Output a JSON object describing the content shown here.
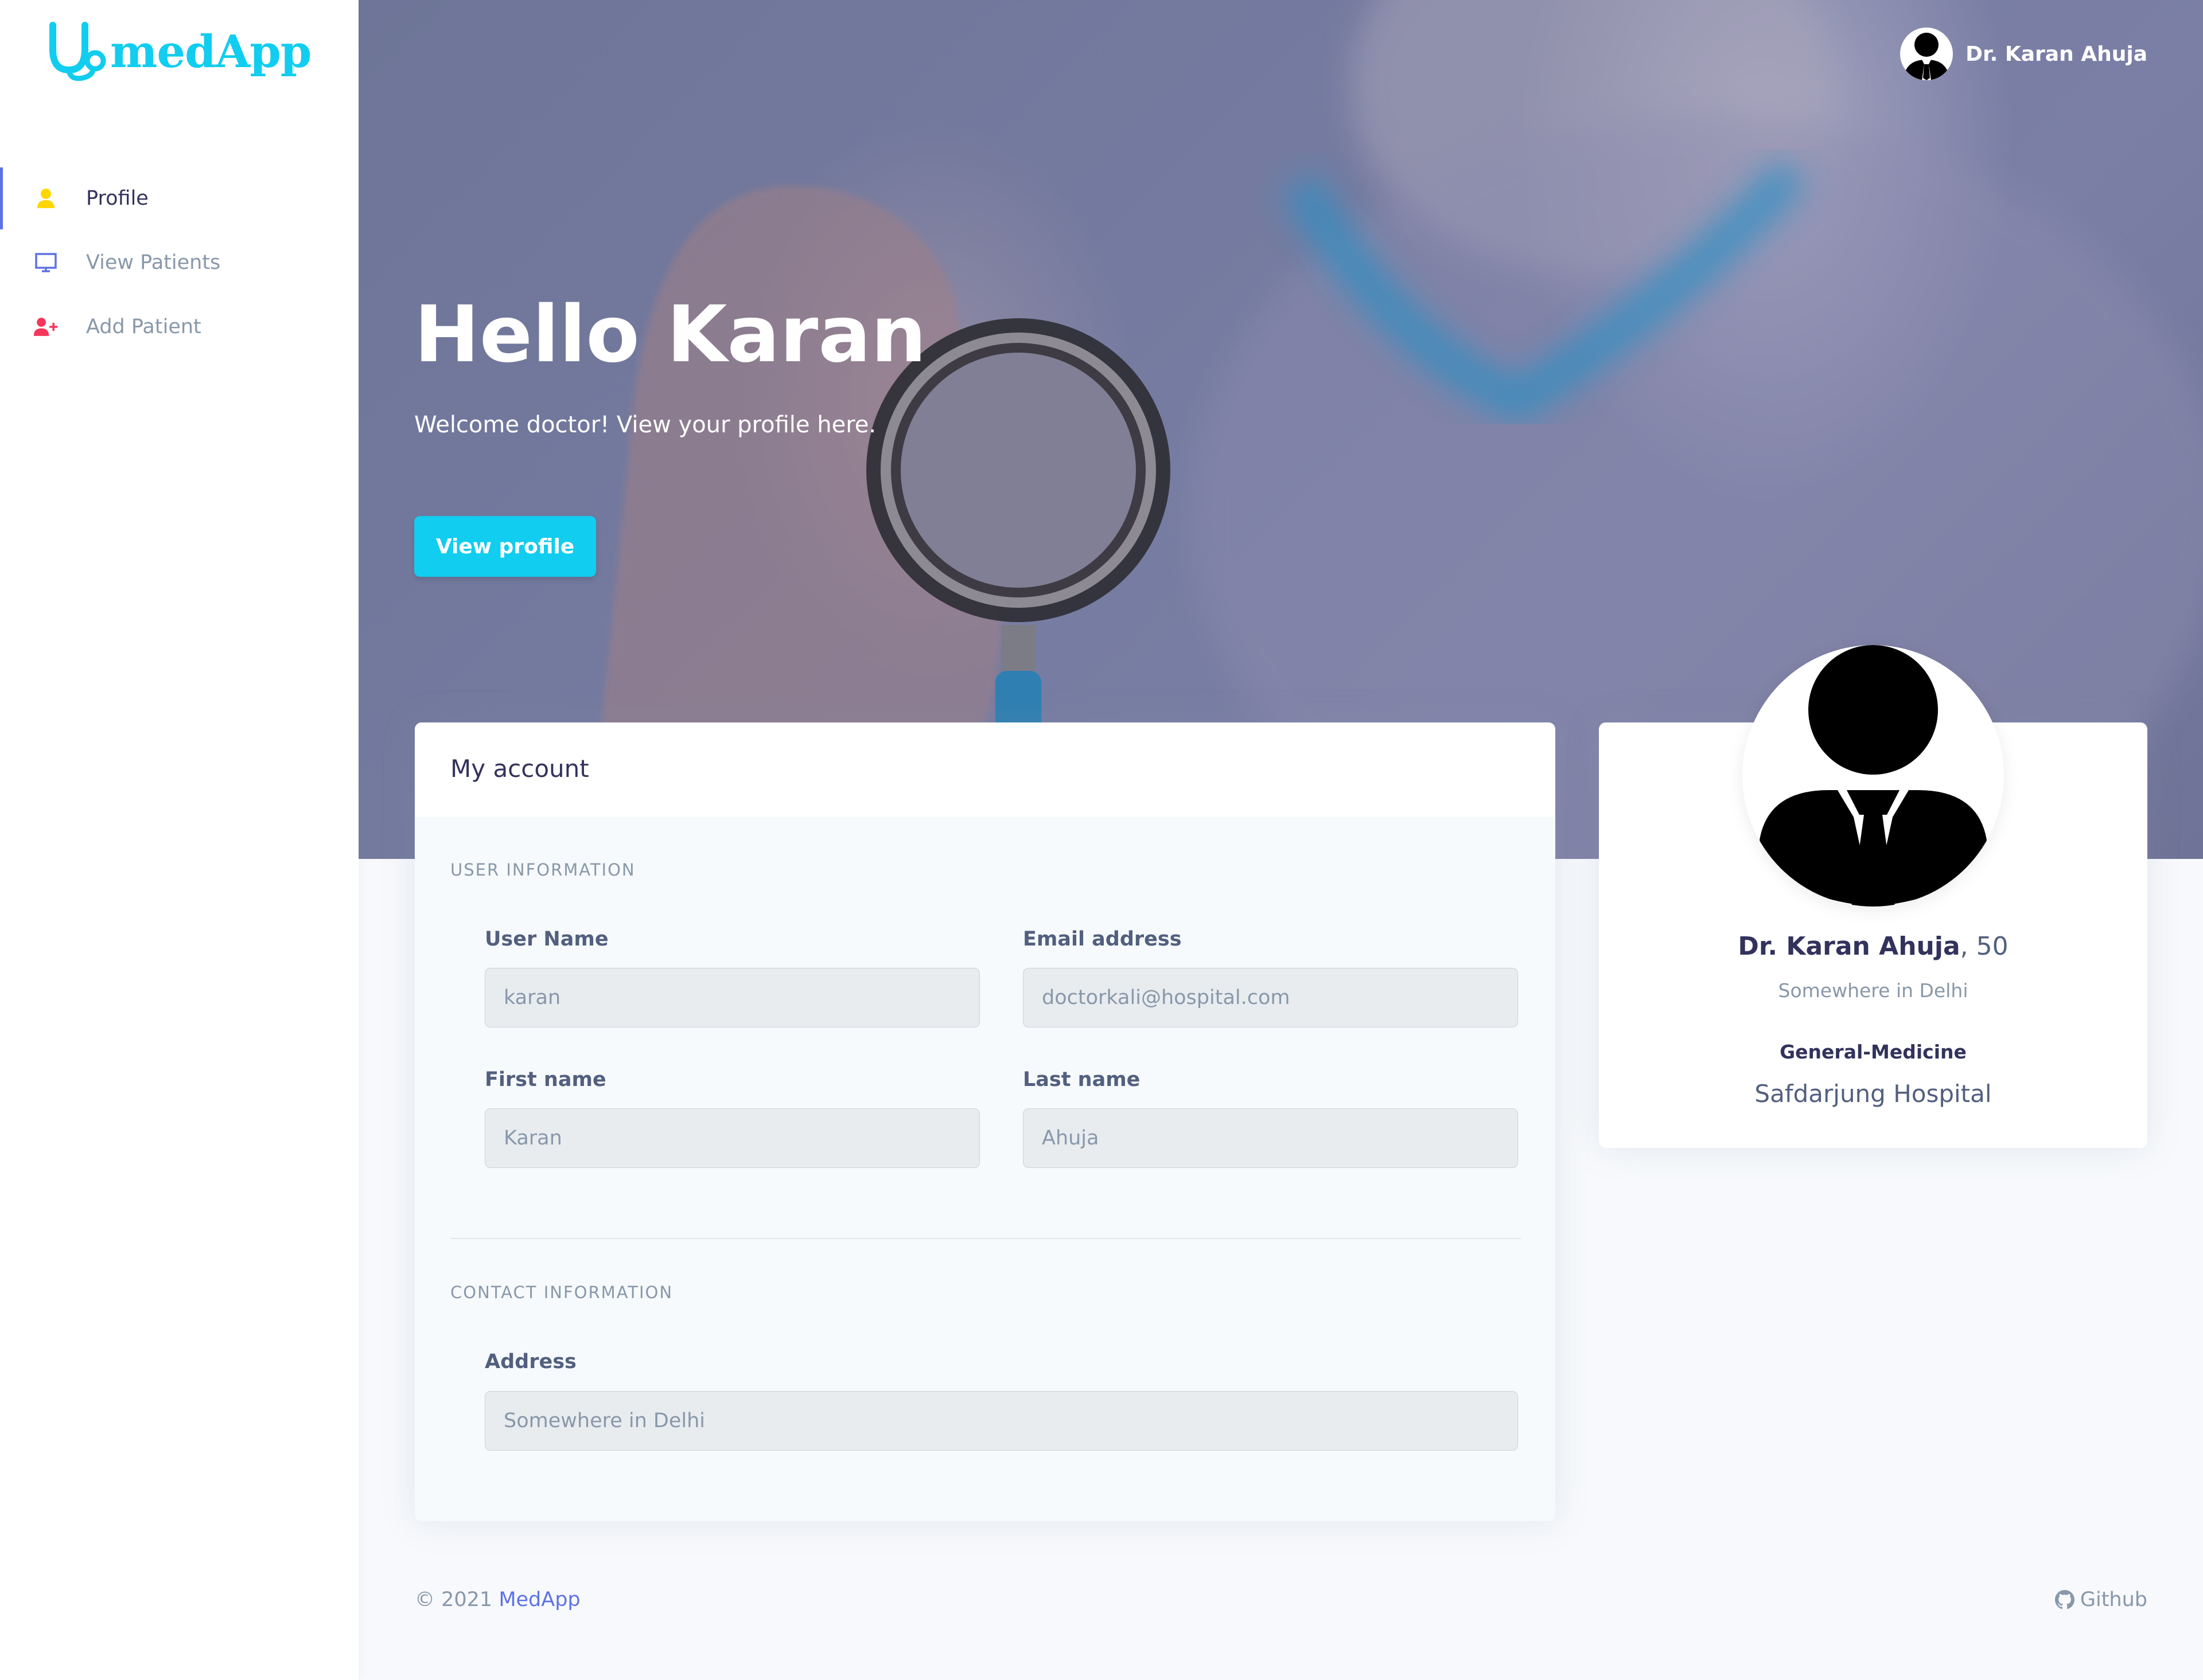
{
  "app": {
    "logo_text": "medApp",
    "brand_color": "#11cdef",
    "accent_color": "#5e72e4"
  },
  "sidebar": {
    "items": [
      {
        "label": "Profile",
        "icon": "user-icon",
        "icon_color": "#ffd600",
        "active": true
      },
      {
        "label": "View Patients",
        "icon": "monitor-icon",
        "icon_color": "#5e72e4",
        "active": false
      },
      {
        "label": "Add Patient",
        "icon": "user-plus-icon",
        "icon_color": "#f5365c",
        "active": false
      }
    ]
  },
  "header": {
    "user_name": "Dr. Karan Ahuja",
    "user_avatar": "avatar-icon"
  },
  "hero": {
    "title": "Hello Karan",
    "subtitle": "Welcome doctor! View your profile here.",
    "button_label": "View profile"
  },
  "account": {
    "title": "My account",
    "user_info_heading": "USER INFORMATION",
    "contact_info_heading": "CONTACT INFORMATION",
    "fields": {
      "username": {
        "label": "User Name",
        "value": "karan"
      },
      "email": {
        "label": "Email address",
        "value": "doctorkali@hospital.com"
      },
      "first_name": {
        "label": "First name",
        "value": "Karan"
      },
      "last_name": {
        "label": "Last name",
        "value": "Ahuja"
      },
      "address": {
        "label": "Address",
        "value": "Somewhere in Delhi"
      }
    }
  },
  "profile": {
    "name": "Dr. Karan Ahuja",
    "age_text": ", 50",
    "location": "Somewhere in Delhi",
    "department": "General-Medicine",
    "hospital": "Safdarjung Hospital"
  },
  "footer": {
    "copyright": "© 2021 ",
    "brand": "MedApp",
    "github_label": "Github",
    "github_icon": "github-icon"
  }
}
